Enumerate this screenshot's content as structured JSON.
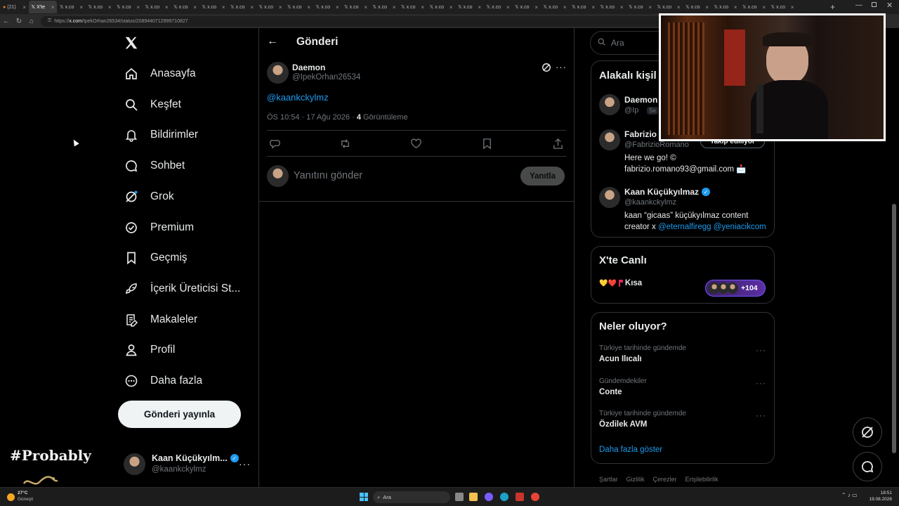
{
  "browser": {
    "tabs": [
      {
        "label": "(21)",
        "active": false
      },
      {
        "label": "X'te",
        "active": true
      },
      {
        "label": "x.co",
        "active": false
      },
      {
        "label": "x.co",
        "active": false
      },
      {
        "label": "x.co",
        "active": false
      },
      {
        "label": "x.co",
        "active": false
      },
      {
        "label": "x.co",
        "active": false
      },
      {
        "label": "x.co",
        "active": false
      },
      {
        "label": "x.co",
        "active": false
      },
      {
        "label": "x.co",
        "active": false
      },
      {
        "label": "x.co",
        "active": false
      },
      {
        "label": "x.co",
        "active": false
      },
      {
        "label": "x.co",
        "active": false
      },
      {
        "label": "x.co",
        "active": false
      },
      {
        "label": "x.co",
        "active": false
      },
      {
        "label": "x.co",
        "active": false
      },
      {
        "label": "x.co",
        "active": false
      },
      {
        "label": "x.co",
        "active": false
      },
      {
        "label": "x.co",
        "active": false
      },
      {
        "label": "x.co",
        "active": false
      },
      {
        "label": "x.co",
        "active": false
      },
      {
        "label": "x.co",
        "active": false
      },
      {
        "label": "x.co",
        "active": false
      },
      {
        "label": "x.co",
        "active": false
      },
      {
        "label": "x.co",
        "active": false
      },
      {
        "label": "x.co",
        "active": false
      },
      {
        "label": "x.co",
        "active": false
      },
      {
        "label": "x.co",
        "active": false
      }
    ],
    "url_prefix": "https://",
    "url_domain": "x.com",
    "url_path": "/IpekOrhan26534/status/2089440712999710827"
  },
  "nav": {
    "items": [
      {
        "label": "Anasayfa",
        "icon": "home-icon"
      },
      {
        "label": "Keşfet",
        "icon": "search-icon"
      },
      {
        "label": "Bildirimler",
        "icon": "bell-icon"
      },
      {
        "label": "Sohbet",
        "icon": "chat-icon"
      },
      {
        "label": "Grok",
        "icon": "grok-icon"
      },
      {
        "label": "Premium",
        "icon": "premium-icon"
      },
      {
        "label": "Geçmiş",
        "icon": "bookmark-icon"
      },
      {
        "label": "İçerik Üreticisi St...",
        "icon": "rocket-icon"
      },
      {
        "label": "Makaleler",
        "icon": "article-icon"
      },
      {
        "label": "Profil",
        "icon": "person-icon"
      },
      {
        "label": "Daha fazla",
        "icon": "more-circle-icon"
      }
    ],
    "post_button": "Gönderi yayınla",
    "account": {
      "name": "Kaan Küçükyılm...",
      "handle": "@kaankckylmz"
    }
  },
  "overlay_text": "#Probably",
  "post": {
    "header_title": "Gönderi",
    "author_name": "Daemon",
    "author_handle": "@IpekOrhan26534",
    "text": "@kaankckylmz",
    "time": "ÖS 10:54 · 17 Ağu 2026 · ",
    "views_count": "4",
    "views_label": " Görüntüleme",
    "reply_placeholder": "Yanıtını gönder",
    "reply_button": "Yanıtla"
  },
  "search": {
    "placeholder": "Ara"
  },
  "related": {
    "title": "Alakalı kişil",
    "people": [
      {
        "name": "Daemon",
        "handle": "@Ip",
        "badge": "Se",
        "bio": "",
        "verified": false
      },
      {
        "name": "Fabrizio R",
        "handle": "@FabrizioRomano",
        "follow": "Takip ediliyor",
        "bio": "Here we go! © fabrizio.romano93@gmail.com 📩",
        "verified": false
      },
      {
        "name": "Kaan Küçükyılmaz",
        "handle": "@kaankckylmz",
        "bio_text": "kaan “gicaas” küçükyılmaz content creator x ",
        "bio_link1": "@eternalfiregg",
        "bio_link2": " @yeniacikcom",
        "verified": true
      }
    ]
  },
  "live": {
    "title": "X'te Canlı",
    "label": "Kısa",
    "emojis": "💛❤️",
    "count": "+104"
  },
  "trends": {
    "title": "Neler oluyor?",
    "items": [
      {
        "context": "Türkiye tarihinde gündemde",
        "name": "Acun Ilıcalı"
      },
      {
        "context": "Gündemdekiler",
        "name": "Conte"
      },
      {
        "context": "Türkiye tarihinde gündemde",
        "name": "Özdilek AVM"
      }
    ],
    "show_more": "Daha fazla göster"
  },
  "footer_links": [
    "Şartlar",
    "Gizlilik",
    "Çerezler",
    "Erişilebilirlik"
  ],
  "taskbar": {
    "weather_temp": "27°C",
    "weather_label": "Güneşli",
    "search_placeholder": "Ara",
    "time": "18:51",
    "date": "19.08.2026"
  },
  "colors": {
    "accent": "#1d9bf0",
    "background": "#000000",
    "border": "#2f3336",
    "muted": "#71767b"
  }
}
